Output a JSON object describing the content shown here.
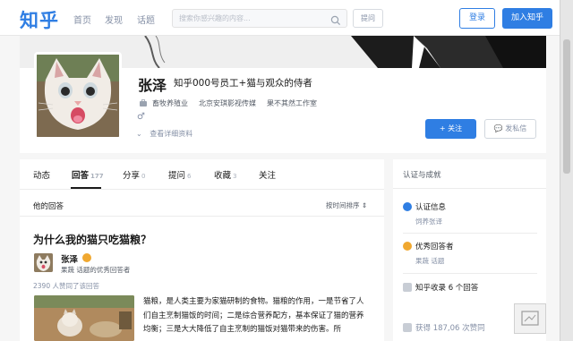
{
  "nav": {
    "logo": "知乎",
    "links": [
      "首页",
      "发现",
      "话题"
    ],
    "search_placeholder": "搜索你感兴趣的内容...",
    "ask_label": "提问",
    "login_label": "登录",
    "join_label": "加入知乎"
  },
  "profile": {
    "name": "张泽",
    "headline": "知乎000号员工+猫与观众的侍者",
    "industry": "畜牧养殖业",
    "company": "北京安琪影视传媒",
    "studio": "果不其然工作室",
    "gender_icon": "♂",
    "more_info": "查看详细资料",
    "follow_label": "+ 关注",
    "message_label": "发私信"
  },
  "tabs": [
    {
      "label": "动态",
      "count": ""
    },
    {
      "label": "回答",
      "count": "177"
    },
    {
      "label": "分享",
      "count": "0"
    },
    {
      "label": "提问",
      "count": "6"
    },
    {
      "label": "收藏",
      "count": "3"
    },
    {
      "label": "关注",
      "count": ""
    }
  ],
  "answers": {
    "section_title": "他的回答",
    "sort_label": "按时间排序",
    "question_title": "为什么我的猫只吃猫粮？",
    "author_name": "张泽",
    "author_bio": "果蔬 话题的优秀回答者",
    "votes": "2390 人赞同了该回答",
    "excerpt": "猫粮，是人类主要为家猫研制的食物。猫粮的作用，一是节省了人们自主烹制猫饭的时间；二是综合营养配方，基本保证了猫的营养均衡；三是大大降低了自主烹制的猫饭对猫带来的伤害。所"
  },
  "sidebar": {
    "title": "认证与成就",
    "verify_title": "认证信息",
    "verify_sub": "饲养张译",
    "excellent_title": "优秀回答者",
    "excellent_sub": "果蔬 话题",
    "collected": "知乎收录 6 个回答",
    "likes": "获得 187,06 次赞同"
  },
  "colors": {
    "brand_blue": "#2f7ee3",
    "gold": "#f0a830"
  }
}
